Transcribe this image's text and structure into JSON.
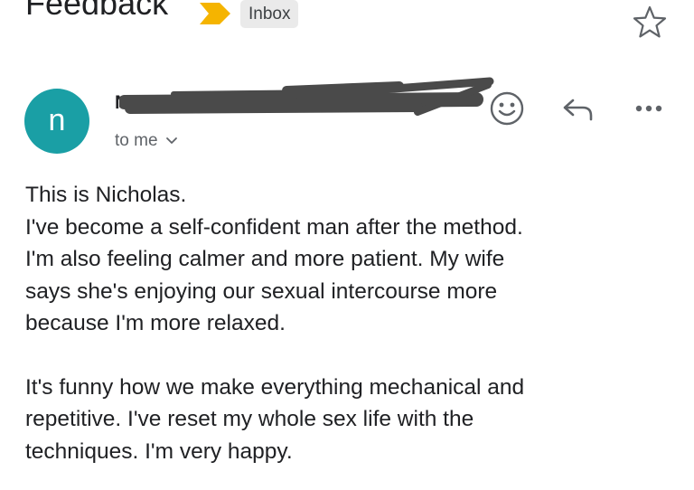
{
  "email": {
    "subject": "Feedback",
    "label": "Inbox",
    "sender": {
      "avatar_letter": "n",
      "name_visible": "N",
      "recipient_text": "to me"
    },
    "body_lines": [
      "This is Nicholas.",
      "I've become a self-confident man after the method.",
      "I'm also feeling calmer and more patient. My wife",
      "says she's enjoying our sexual intercourse more",
      "because I'm more relaxed.",
      "It's funny how we make everything mechanical and",
      "repetitive. I've reset my whole sex life with the",
      "techniques. I'm very happy."
    ]
  },
  "icons": {
    "importance": "importance-marker-icon",
    "star": "star-outline-icon",
    "emoji": "smiley-icon",
    "reply": "reply-arrow-icon",
    "more": "more-horizontal-icon",
    "chevron": "chevron-down-icon"
  },
  "colors": {
    "avatar_bg": "#1a9fa5",
    "importance_marker": "#f5b400",
    "chip_bg": "#eaeaea",
    "redaction": "#4a4a4a",
    "secondary_text": "#5f6368",
    "icon": "#5f6368",
    "text": "#202124"
  }
}
